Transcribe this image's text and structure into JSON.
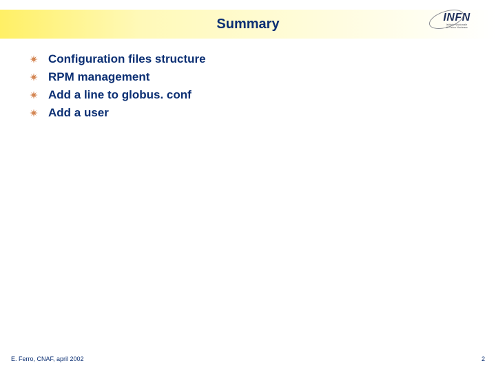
{
  "title": "Summary",
  "logo": {
    "text": "INFN",
    "sub1": "Istituto Nazionale",
    "sub2": "di Fisica Nucleare"
  },
  "bullets": [
    "Configuration files structure",
    "RPM management",
    "Add a line to globus. conf",
    "Add a user"
  ],
  "footer": {
    "left": "E. Ferro, CNAF, april 2002",
    "right": "2"
  },
  "colors": {
    "bullet_glyph": "#c65f1d",
    "text": "#0b2f73"
  }
}
